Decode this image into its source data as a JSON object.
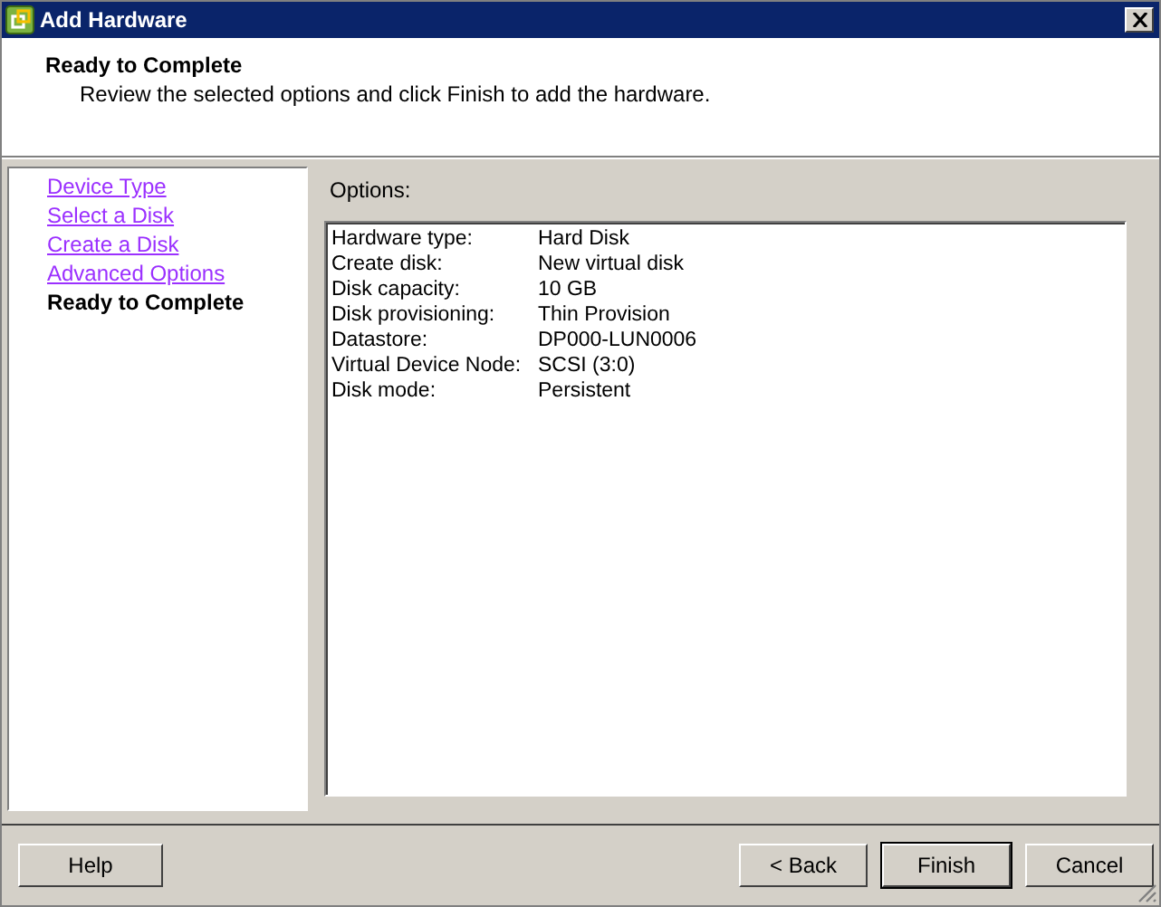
{
  "window": {
    "title": "Add Hardware"
  },
  "header": {
    "title": "Ready to Complete",
    "subtitle": "Review the selected options and click Finish to add the hardware."
  },
  "steps": [
    {
      "label": "Device Type",
      "selected": false
    },
    {
      "label": "Select a Disk",
      "selected": false
    },
    {
      "label": "Create a Disk",
      "selected": false
    },
    {
      "label": "Advanced Options",
      "selected": false
    },
    {
      "label": "Ready to Complete",
      "selected": true
    }
  ],
  "options": {
    "label": "Options:",
    "rows": [
      {
        "name": "Hardware type:",
        "value": "Hard Disk"
      },
      {
        "name": "Create disk:",
        "value": "New virtual disk"
      },
      {
        "name": "Disk capacity:",
        "value": "10 GB"
      },
      {
        "name": "Disk provisioning:",
        "value": "Thin Provision"
      },
      {
        "name": "Datastore:",
        "value": "DP000-LUN0006"
      },
      {
        "name": "Virtual Device Node:",
        "value": "SCSI (3:0)"
      },
      {
        "name": "Disk mode:",
        "value": "Persistent"
      }
    ]
  },
  "buttons": [
    {
      "kind": "help",
      "label": "Help",
      "default": false
    },
    {
      "kind": "back",
      "label": "< Back",
      "default": false
    },
    {
      "kind": "finish",
      "label": "Finish",
      "default": true
    },
    {
      "kind": "cancel",
      "label": "Cancel",
      "default": false
    }
  ]
}
